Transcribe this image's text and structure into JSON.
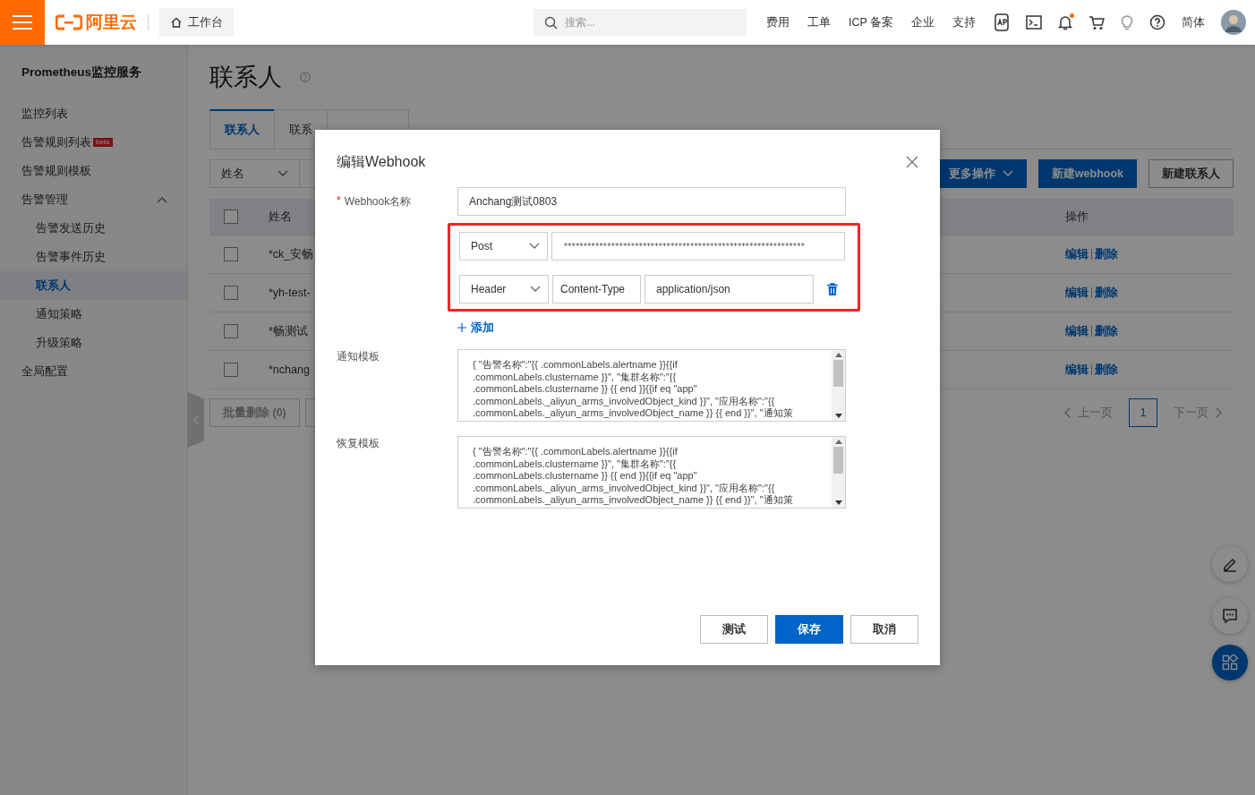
{
  "top_bar": {
    "logo": "阿里云",
    "workbench": "工作台",
    "search": {
      "placeholder": "搜索..."
    },
    "nav": [
      "费用",
      "工单",
      "ICP 备案",
      "企业",
      "支持"
    ],
    "notification_dot": true,
    "language": "简体"
  },
  "sidebar": {
    "title": "Prometheus监控服务",
    "items": [
      {
        "label": "监控列表",
        "selected": false
      },
      {
        "label": "告警规则列表",
        "badge": "beta",
        "selected": false
      },
      {
        "label": "告警规则模板",
        "selected": false
      },
      {
        "label": "告警管理",
        "selected": false,
        "expanded": true,
        "children": [
          {
            "label": "告警发送历史",
            "selected": false
          },
          {
            "label": "告警事件历史",
            "selected": false
          },
          {
            "label": "联系人",
            "selected": true
          },
          {
            "label": "通知策略",
            "selected": false
          },
          {
            "label": "升级策略",
            "selected": false
          }
        ]
      },
      {
        "label": "全局配置",
        "selected": false
      }
    ]
  },
  "page": {
    "title": "联系人",
    "tabs": [
      {
        "label": "联系人",
        "selected": true
      },
      {
        "label": "联系",
        "selected": false
      },
      {
        "selected": false
      }
    ],
    "filter": {
      "value": "姓名"
    },
    "actions": [
      {
        "label": "更多操作",
        "kind": "dropdown"
      },
      {
        "label": "新建webhook",
        "kind": "primary"
      },
      {
        "label": "新建联系人",
        "kind": "default"
      }
    ],
    "table": {
      "columns": [
        "姓名",
        "操作"
      ],
      "select_all": false,
      "rows": [
        {
          "checked": false,
          "name": "*ck_安畅",
          "actions": [
            "编辑",
            "删除"
          ]
        },
        {
          "checked": false,
          "name": "*yh-test-",
          "actions": [
            "编辑",
            "删除"
          ]
        },
        {
          "checked": false,
          "name": "*畅测试",
          "actions": [
            "编辑",
            "删除"
          ]
        },
        {
          "checked": false,
          "name": "*nchang",
          "actions": [
            "编辑",
            "删除"
          ]
        }
      ]
    },
    "batch_delete": "批量删除 (0)",
    "pagination": {
      "prev": "上一页",
      "pages": [
        {
          "label": "1",
          "selected": true
        }
      ],
      "next": "下一页"
    }
  },
  "dialog": {
    "title": "编辑Webhook",
    "name_field": {
      "required_mark": "*",
      "label": "Webhook名称",
      "value": "Anchang测试0803"
    },
    "request": {
      "highlighted": true,
      "method": "Post",
      "url": "*************************************************************",
      "headers": [
        {
          "type": "Header",
          "key": "Content-Type",
          "value": "application/json"
        }
      ]
    },
    "add": "添加",
    "templates": [
      {
        "label": "通知模板",
        "lines": [
          "{ \"告警名称\":\"{{ .commonLabels.alertname }}{{if",
          ".commonLabels.clustername }}\", \"集群名称\":\"{{",
          ".commonLabels.clustername }} {{ end }}{{if eq \"app\"",
          ".commonLabels._aliyun_arms_involvedObject_kind }}\", \"应用名称\":\"{{",
          ".commonLabels._aliyun_arms_involvedObject_name }} {{ end }}\", \"通知策"
        ]
      },
      {
        "label": "恢复模板",
        "lines": [
          "{ \"告警名称\":\"{{ .commonLabels.alertname }}{{if",
          ".commonLabels.clustername }}\", \"集群名称\":\"{{",
          ".commonLabels.clustername }} {{ end }}{{if eq \"app\"",
          ".commonLabels._aliyun_arms_involvedObject_kind }}\", \"应用名称\":\"{{",
          ".commonLabels._aliyun_arms_involvedObject_name }} {{ end }}\", \"通知策"
        ]
      }
    ],
    "buttons": [
      {
        "label": "测试",
        "kind": "default"
      },
      {
        "label": "保存",
        "kind": "primary"
      },
      {
        "label": "取消",
        "kind": "default"
      }
    ]
  }
}
